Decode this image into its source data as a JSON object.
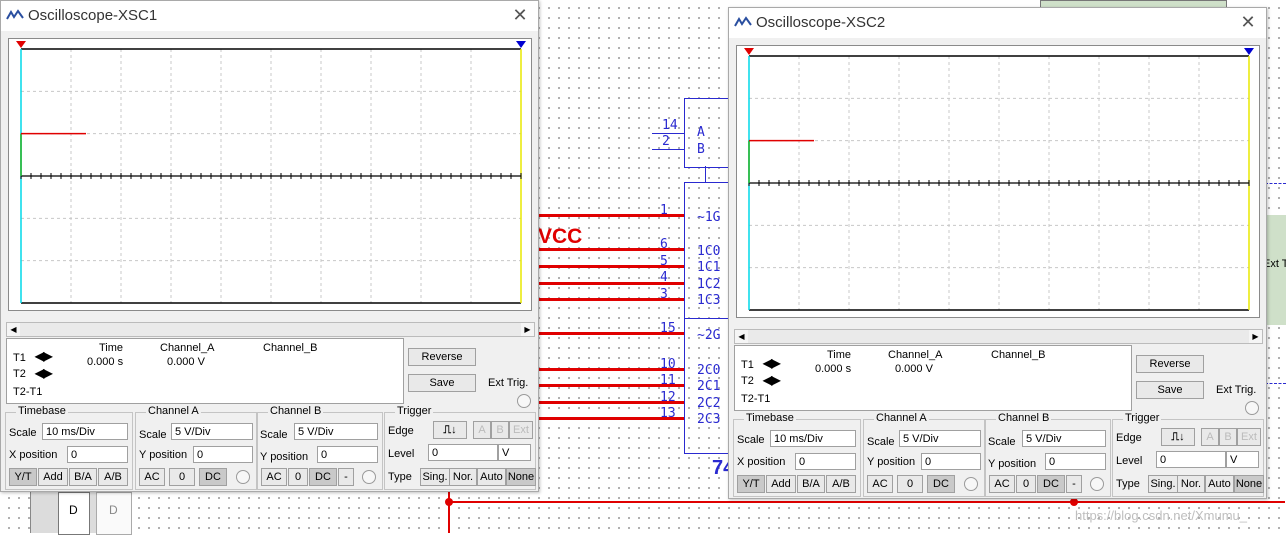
{
  "colors": {
    "trace_a": "#e00000",
    "trace_b": "#2a2ad0",
    "cursor_t1": "#e00000",
    "cursor_t2": "#0000d0",
    "grid": "#c8c8c8",
    "wire_red": "#e00000",
    "wire_blue": "#2a2ad0"
  },
  "schematic": {
    "vcc_label": "VCC",
    "pins_top": [
      "14",
      "2"
    ],
    "pin_ab": [
      "A",
      "B"
    ],
    "pins_g1": [
      "1",
      "6",
      "5",
      "4",
      "3"
    ],
    "labels_g1": [
      "~1G",
      "1C0",
      "1C1",
      "1C2",
      "1C3"
    ],
    "pins_g2": [
      "15",
      "10",
      "11",
      "12",
      "13"
    ],
    "labels_g2": [
      "~2G",
      "2C0",
      "2C1",
      "2C2",
      "2C3"
    ],
    "part_prefix": "74",
    "ext_label": "Ext T",
    "left_d_labels": [
      "D",
      "D"
    ]
  },
  "scopes": [
    {
      "title": "Oscilloscope-XSC1",
      "readout": {
        "time_header": "Time",
        "cha_header": "Channel_A",
        "chb_header": "Channel_B",
        "t1": "T1",
        "t2": "T2",
        "t2t1": "T2-T1",
        "time_value": "0.000 s",
        "cha_value": "0.000 V"
      },
      "buttons": {
        "reverse": "Reverse",
        "save": "Save",
        "ext_trig": "Ext Trig."
      },
      "timebase": {
        "title": "Timebase",
        "scale_label": "Scale",
        "scale": "10 ms/Div",
        "xpos_label": "X position",
        "xpos": "0",
        "modes": [
          "Y/T",
          "Add",
          "B/A",
          "A/B"
        ]
      },
      "channel_a": {
        "title": "Channel A",
        "scale_label": "Scale",
        "scale": "5  V/Div",
        "ypos_label": "Y position",
        "ypos": "0",
        "coupling": [
          "AC",
          "0",
          "DC"
        ]
      },
      "channel_b": {
        "title": "Channel B",
        "scale_label": "Scale",
        "scale": "5  V/Div",
        "ypos_label": "Y position",
        "ypos": "0",
        "coupling": [
          "AC",
          "0",
          "DC",
          "-"
        ]
      },
      "trigger": {
        "title": "Trigger",
        "edge_label": "Edge",
        "level_label": "Level",
        "level": "0",
        "level_unit": "V",
        "type_label": "Type",
        "types": [
          "Sing.",
          "Nor.",
          "Auto",
          "None"
        ],
        "source_buttons": [
          "A",
          "B",
          "Ext"
        ]
      }
    },
    {
      "title": "Oscilloscope-XSC2",
      "readout": {
        "time_header": "Time",
        "cha_header": "Channel_A",
        "chb_header": "Channel_B",
        "t1": "T1",
        "t2": "T2",
        "t2t1": "T2-T1",
        "time_value": "0.000 s",
        "cha_value": "0.000 V"
      },
      "buttons": {
        "reverse": "Reverse",
        "save": "Save",
        "ext_trig": "Ext Trig."
      },
      "timebase": {
        "title": "Timebase",
        "scale_label": "Scale",
        "scale": "10 ms/Div",
        "xpos_label": "X position",
        "xpos": "0",
        "modes": [
          "Y/T",
          "Add",
          "B/A",
          "A/B"
        ]
      },
      "channel_a": {
        "title": "Channel A",
        "scale_label": "Scale",
        "scale": "5  V/Div",
        "ypos_label": "Y position",
        "ypos": "0",
        "coupling": [
          "AC",
          "0",
          "DC"
        ]
      },
      "channel_b": {
        "title": "Channel B",
        "scale_label": "Scale",
        "scale": "5  V/Div",
        "ypos_label": "Y position",
        "ypos": "0",
        "coupling": [
          "AC",
          "0",
          "DC",
          "-"
        ]
      },
      "trigger": {
        "title": "Trigger",
        "edge_label": "Edge",
        "level_label": "Level",
        "level": "0",
        "level_unit": "V",
        "type_label": "Type",
        "types": [
          "Sing.",
          "Nor.",
          "Auto",
          "None"
        ],
        "source_buttons": [
          "A",
          "B",
          "Ext"
        ]
      }
    }
  ],
  "chart_data": [
    {
      "type": "line",
      "title": "",
      "divisions_x": 10,
      "divisions_y": 6,
      "series": [
        {
          "name": "Channel_A",
          "x": [
            0,
            1.3
          ],
          "y": [
            1,
            1
          ]
        }
      ],
      "xlim": [
        0,
        10
      ],
      "ylim": [
        -3,
        3
      ],
      "grid": true
    },
    {
      "type": "line",
      "title": "",
      "divisions_x": 10,
      "divisions_y": 6,
      "series": [
        {
          "name": "Channel_A",
          "x": [
            0,
            1.3
          ],
          "y": [
            1,
            1
          ]
        }
      ],
      "xlim": [
        0,
        10
      ],
      "ylim": [
        -3,
        3
      ],
      "grid": true
    }
  ],
  "watermark": "https://blog.csdn.net/Xmumu_"
}
